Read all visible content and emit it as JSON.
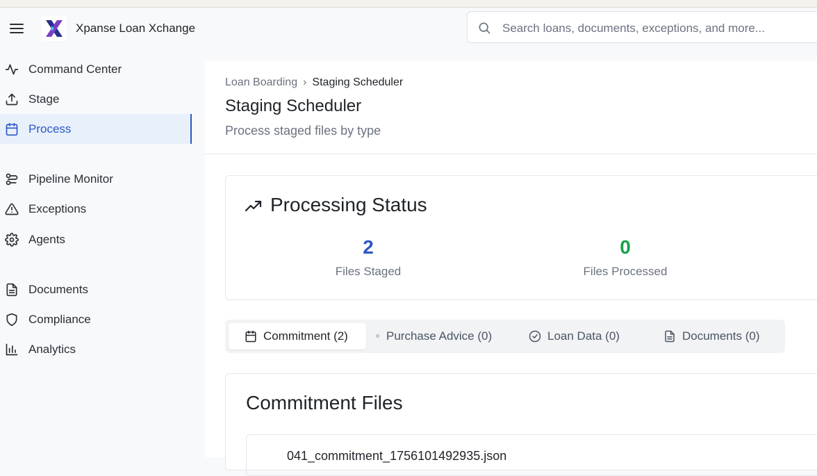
{
  "app": {
    "title": "Xpanse Loan Xchange"
  },
  "search": {
    "placeholder": "Search loans, documents, exceptions, and more..."
  },
  "sidebar": {
    "items": [
      {
        "label": "Command Center",
        "icon": "activity-icon"
      },
      {
        "label": "Stage",
        "icon": "upload-icon"
      },
      {
        "label": "Process",
        "icon": "calendar-icon",
        "active": true
      },
      {
        "label": "Pipeline Monitor",
        "icon": "workflow-icon"
      },
      {
        "label": "Exceptions",
        "icon": "warning-triangle-icon"
      },
      {
        "label": "Agents",
        "icon": "gear-icon"
      },
      {
        "label": "Documents",
        "icon": "document-icon"
      },
      {
        "label": "Compliance",
        "icon": "shield-icon"
      },
      {
        "label": "Analytics",
        "icon": "bar-chart-icon"
      }
    ]
  },
  "breadcrumb": {
    "parent": "Loan Boarding",
    "separator": "›",
    "current": "Staging Scheduler"
  },
  "page": {
    "title": "Staging Scheduler",
    "subtitle": "Process staged files by type"
  },
  "status": {
    "title": "Processing Status",
    "stats": [
      {
        "value": "2",
        "label": "Files Staged",
        "color": "#2b59c3"
      },
      {
        "value": "0",
        "label": "Files Processed",
        "color": "#16a34a"
      }
    ]
  },
  "tabs": [
    {
      "label": "Commitment (2)",
      "icon": "calendar-icon",
      "active": true
    },
    {
      "label": "Purchase Advice (0)",
      "icon": "dot-icon"
    },
    {
      "label": "Loan Data (0)",
      "icon": "check-circle-icon"
    },
    {
      "label": "Documents (0)",
      "icon": "document-icon"
    }
  ],
  "files": {
    "title": "Commitment Files",
    "items": [
      {
        "name": "041_commitment_1756101492935.json"
      }
    ]
  },
  "colors": {
    "accent": "#2b59c3",
    "success": "#16a34a",
    "active_bg": "#e8f0fc"
  }
}
